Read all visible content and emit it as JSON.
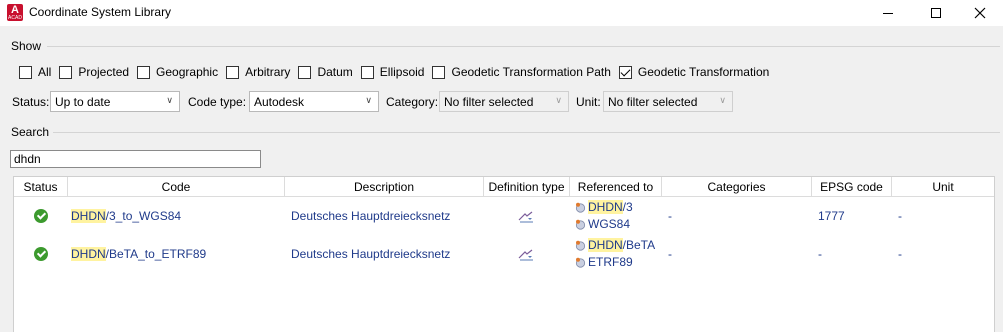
{
  "window": {
    "title": "Coordinate System Library",
    "app_icon_letter": "A",
    "app_icon_sub": "ACAD"
  },
  "show": {
    "label": "Show",
    "checkboxes": [
      {
        "label": "All",
        "checked": false
      },
      {
        "label": "Projected",
        "checked": false
      },
      {
        "label": "Geographic",
        "checked": false
      },
      {
        "label": "Arbitrary",
        "checked": false
      },
      {
        "label": "Datum",
        "checked": false
      },
      {
        "label": "Ellipsoid",
        "checked": false
      },
      {
        "label": "Geodetic Transformation Path",
        "checked": false
      },
      {
        "label": "Geodetic Transformation",
        "checked": true
      }
    ]
  },
  "filters": {
    "status_label": "Status:",
    "status_value": "Up to date",
    "code_type_label": "Code type:",
    "code_type_value": "Autodesk",
    "category_label": "Category:",
    "category_value": "No filter selected",
    "unit_label": "Unit:",
    "unit_value": "No filter selected"
  },
  "search": {
    "label": "Search",
    "value": "dhdn"
  },
  "table": {
    "columns": [
      "Status",
      "Code",
      "Description",
      "Definition type",
      "Referenced to",
      "Categories",
      "EPSG code",
      "Unit"
    ],
    "rows": [
      {
        "status": "up-to-date",
        "code_match": "DHDN",
        "code_rest": "/3_to_WGS84",
        "description": "Deutsches Hauptdreiecksnetz",
        "referenced_to": [
          {
            "match": "DHDN",
            "rest": "/3"
          },
          {
            "match": "",
            "rest": "WGS84"
          }
        ],
        "categories": "-",
        "epsg_code": "1777",
        "unit": "-"
      },
      {
        "status": "up-to-date",
        "code_match": "DHDN",
        "code_rest": "/BeTA_to_ETRF89",
        "description": "Deutsches Hauptdreiecksnetz",
        "referenced_to": [
          {
            "match": "DHDN",
            "rest": "/BeTA"
          },
          {
            "match": "",
            "rest": "ETRF89"
          }
        ],
        "categories": "-",
        "epsg_code": "-",
        "unit": "-"
      }
    ]
  },
  "colors": {
    "link_text": "#1f3a8a",
    "highlight": "#fff3a0",
    "status_ok": "#3c9a2e",
    "app_icon": "#c8102e"
  }
}
